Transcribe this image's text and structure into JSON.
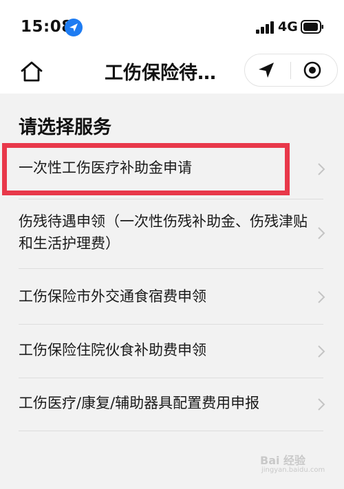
{
  "status_bar": {
    "time": "15:08",
    "network": "4G",
    "icons": [
      "location-arrow-icon",
      "signal-icon",
      "battery-icon"
    ]
  },
  "nav_bar": {
    "title": "工伤保险待…",
    "icons": [
      "home-icon",
      "location-icon",
      "record-icon"
    ]
  },
  "section": {
    "title": "请选择服务"
  },
  "services": [
    {
      "label": "一次性工伤医疗补助金申请"
    },
    {
      "label": "伤残待遇申领（一次性伤残补助金、伤残津贴和生活护理费）"
    },
    {
      "label": "工伤保险市外交通食宿费申领"
    },
    {
      "label": "工伤保险住院伙食补助费申领"
    },
    {
      "label": "工伤医疗/康复/辅助器具配置费用申报"
    }
  ],
  "colors": {
    "highlight": "#e8384a",
    "accent": "#1e7cf2",
    "background": "#f2f2f2"
  },
  "watermark": {
    "main": "Bai 经验",
    "sub": "jingyan.baidu.com"
  }
}
